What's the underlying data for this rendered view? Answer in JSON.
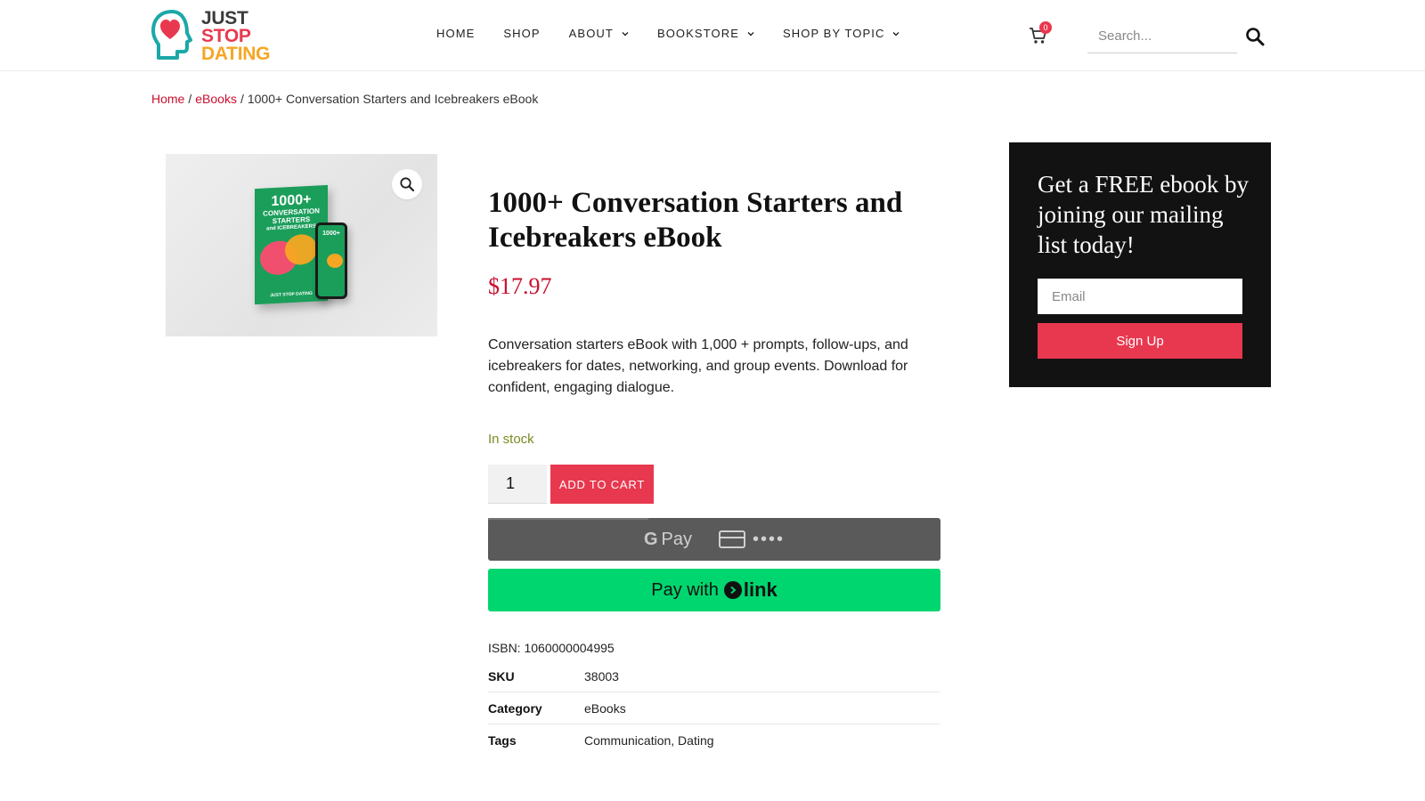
{
  "logo": {
    "line1": "JUST",
    "line2": "STOP",
    "line3": "DATING"
  },
  "nav": {
    "items": [
      {
        "label": "HOME"
      },
      {
        "label": "SHOP"
      },
      {
        "label": "ABOUT"
      },
      {
        "label": "BOOKSTORE"
      },
      {
        "label": "SHOP BY TOPIC"
      }
    ]
  },
  "cart": {
    "count": "0"
  },
  "search": {
    "placeholder": "Search..."
  },
  "breadcrumb": {
    "home": "Home",
    "category": "eBooks",
    "separator": "/",
    "current": "1000+ Conversation Starters and Icebreakers eBook"
  },
  "cover": {
    "title": "1000+",
    "subtitle1": "CONVERSATION",
    "subtitle2": "STARTERS",
    "subtitle3": "and ICEBREAKERS",
    "footer": "JUST STOP DATING",
    "phone_title": "1000+"
  },
  "product": {
    "title": "1000+ Conversation Starters and Icebreakers eBook",
    "price": "$17.97",
    "description": "Conversation starters eBook with 1,000 + prompts, follow-ups, and icebreakers for dates, networking, and group events. Download for confident, engaging dialogue.",
    "stock": "In stock",
    "quantity": "1",
    "add_to_cart": "ADD TO CART",
    "isbn": "ISBN: 1060000004995"
  },
  "payments": {
    "gpay_g": "G",
    "gpay_label": "Pay",
    "gpay_dots": "••••",
    "link_prefix": "Pay with",
    "link_brand": "link"
  },
  "meta": [
    {
      "key": "SKU",
      "value": "38003"
    },
    {
      "key": "Category",
      "value": "eBooks"
    },
    {
      "key": "Tags",
      "value": "Communication, Dating"
    }
  ],
  "newsletter": {
    "title": "Get a FREE ebook by joining our mailing list today!",
    "email_placeholder": "Email",
    "button": "Sign Up"
  },
  "colors": {
    "accent": "#e8384f",
    "link": "#c8102e",
    "stock": "#7b8a24",
    "link_pay": "#00d66f",
    "newsletter_bg": "#121212"
  }
}
